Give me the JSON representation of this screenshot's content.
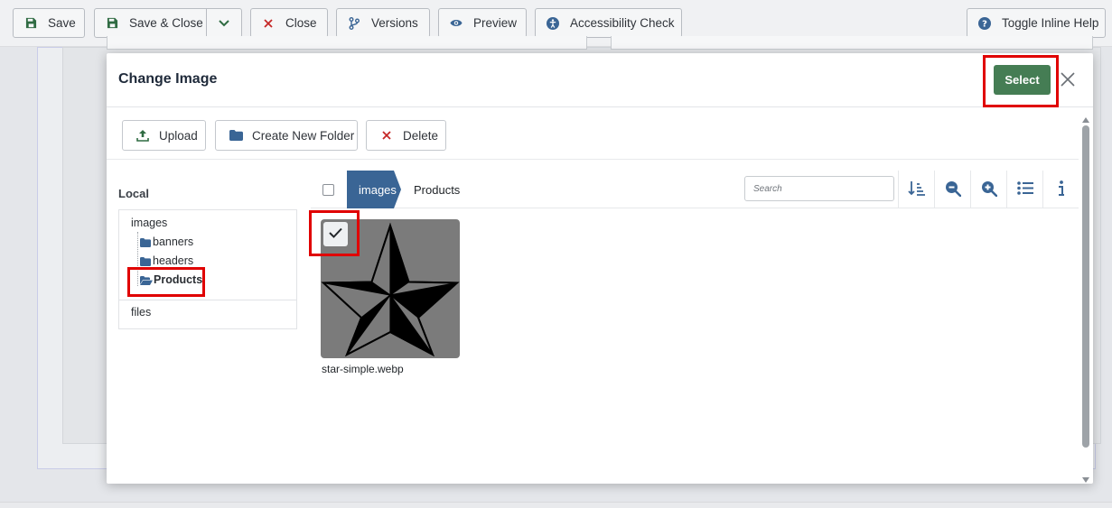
{
  "toolbar": {
    "save": "Save",
    "save_close": "Save & Close",
    "close": "Close",
    "versions": "Versions",
    "preview": "Preview",
    "accessibility": "Accessibility Check",
    "help": "Toggle Inline Help"
  },
  "modal": {
    "title": "Change Image",
    "select": "Select"
  },
  "actions": {
    "upload": "Upload",
    "new_folder": "Create New Folder",
    "delete": "Delete"
  },
  "tree": {
    "title": "Local",
    "root": "images",
    "folders": [
      "banners",
      "headers",
      "Products"
    ],
    "selected": "Products",
    "files": "files"
  },
  "browser": {
    "breadcrumb": [
      "images",
      "Products"
    ],
    "search_placeholder": "Search",
    "items": [
      {
        "name": "star-simple.webp",
        "selected": true
      }
    ]
  },
  "colors": {
    "primary": "#3a6595",
    "success": "#457d54",
    "highlight": "#e00000",
    "danger": "#c52827"
  }
}
